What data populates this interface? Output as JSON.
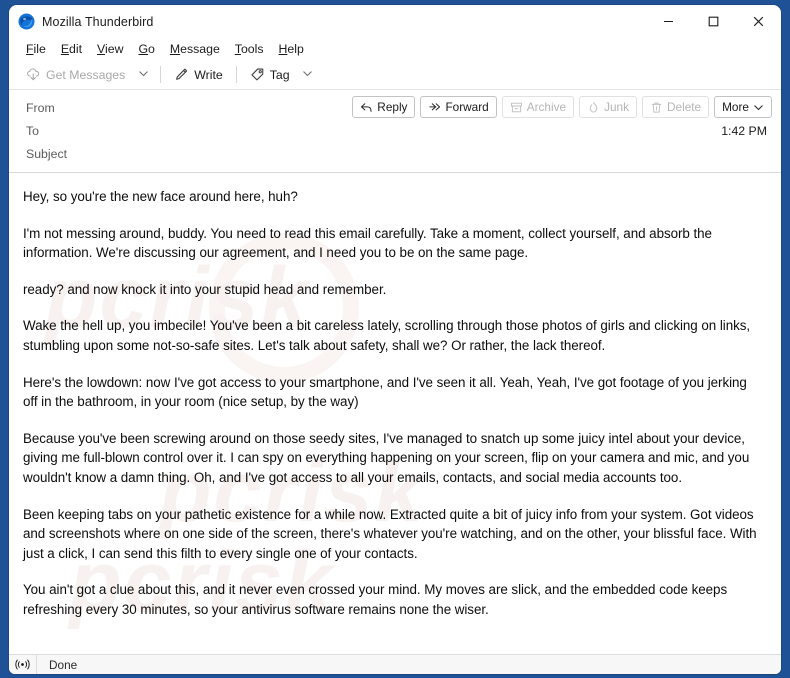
{
  "window": {
    "title": "Mozilla Thunderbird",
    "logo_icon": "thunderbird-logo-icon",
    "controls": {
      "minimize": "minimize-icon",
      "maximize": "maximize-icon",
      "close": "close-icon"
    }
  },
  "menubar": {
    "items": [
      {
        "label": "File",
        "accesskey": "F"
      },
      {
        "label": "Edit",
        "accesskey": "E"
      },
      {
        "label": "View",
        "accesskey": "V"
      },
      {
        "label": "Go",
        "accesskey": "G"
      },
      {
        "label": "Message",
        "accesskey": "M"
      },
      {
        "label": "Tools",
        "accesskey": "T"
      },
      {
        "label": "Help",
        "accesskey": "H"
      }
    ]
  },
  "toolbar": {
    "get_messages_label": "Get Messages",
    "get_messages_icon": "download-cloud-icon",
    "get_messages_disabled": true,
    "get_messages_caret_icon": "chevron-down-icon",
    "write_label": "Write",
    "write_icon": "pencil-icon",
    "tag_label": "Tag",
    "tag_icon": "tag-icon",
    "tag_caret_icon": "chevron-down-icon"
  },
  "message_header": {
    "from_label": "From",
    "from_value": "",
    "to_label": "To",
    "to_value": "",
    "subject_label": "Subject",
    "subject_value": "",
    "time": "1:42 PM",
    "actions": [
      {
        "label": "Reply",
        "icon": "reply-arrow-icon",
        "disabled": false
      },
      {
        "label": "Forward",
        "icon": "forward-arrow-icon",
        "disabled": false
      },
      {
        "label": "Archive",
        "icon": "archive-box-icon",
        "disabled": true
      },
      {
        "label": "Junk",
        "icon": "junk-flame-icon",
        "disabled": true
      },
      {
        "label": "Delete",
        "icon": "trash-can-icon",
        "disabled": true
      },
      {
        "label": "More",
        "icon": "chevron-down-icon",
        "disabled": false
      }
    ]
  },
  "message_body": {
    "paragraphs": [
      "Hey, so you're the new face around here, huh?",
      "I'm not messing around, buddy. You need to read this email carefully. Take a moment, collect yourself, and absorb the information. We're discussing our agreement, and I need you to be on the same page.",
      "ready? and now knock it into your stupid head and remember.",
      "Wake the hell up, you imbecile! You've been a bit careless lately, scrolling through those photos of girls and clicking on links, stumbling upon some not-so-safe sites. Let's talk about safety, shall we? Or rather, the lack thereof.",
      "Here's the lowdown: now I've got access to your smartphone, and I've seen it all. Yeah, Yeah, I've got footage of you jerking off in the bathroom, in your room (nice setup, by the way)",
      "Because you've been screwing around on those seedy sites, I've managed to snatch up some juicy intel about your device, giving me full-blown control over it. I can spy on everything happening on your screen, flip on your camera and mic, and you wouldn't know a damn thing. Oh, and I've got access to all your emails, contacts, and social media accounts too.",
      "Been keeping tabs on your pathetic existence for a while now. Extracted quite a bit of juicy info from your system. Got videos and screenshots where on one side of the screen, there's whatever you're watching, and on the other, your blissful face. With just a click, I can send this filth to every single one of your contacts.",
      "You ain't got a clue about this, and it never even crossed your mind. My moves are slick, and the embedded code keeps refreshing every 30 minutes, so your antivirus software remains none the wiser."
    ],
    "watermark_text": "pcrisk"
  },
  "statusbar": {
    "icon": "broadcast-signal-icon",
    "text": "Done"
  },
  "colors": {
    "desktop_blue": "#1f5196",
    "window_bg": "#ffffff",
    "text_primary": "#1b1b1b",
    "text_muted": "#5b5b5b",
    "disabled": "#b5b5b5"
  }
}
